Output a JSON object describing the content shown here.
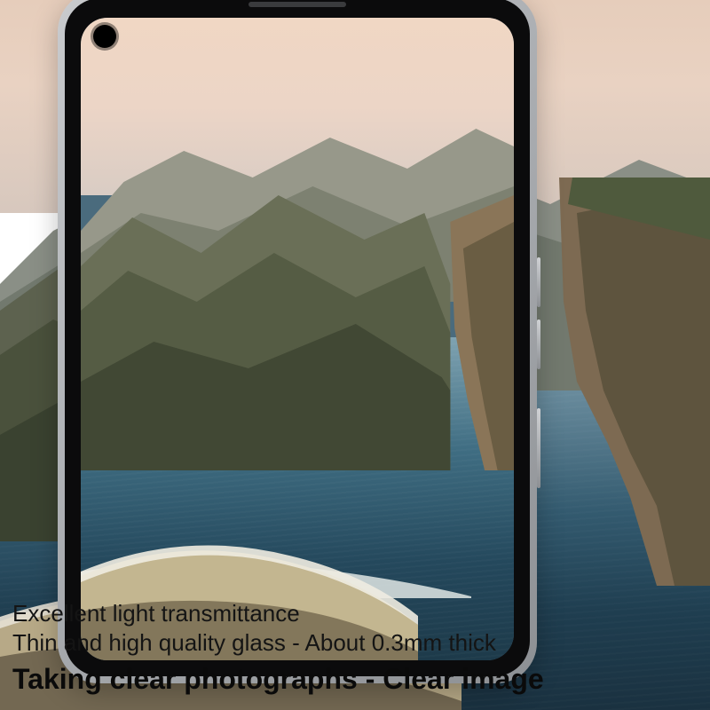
{
  "caption": {
    "line1": "Excellent light transmittance",
    "line2": "Thin and high quality glass - About 0.3mm thick",
    "line3": "Taking clear photographs - Clear image"
  }
}
